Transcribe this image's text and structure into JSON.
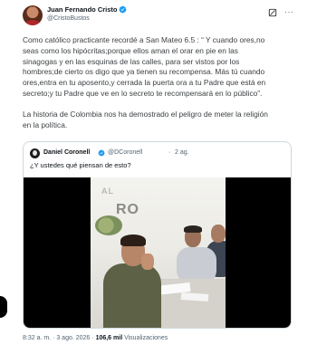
{
  "author": {
    "name": "Juan Fernando Cristo",
    "handle": "@CristoBustos"
  },
  "tweet": {
    "paragraph1": "Como católico practicante recordé a San Mateo 6.5 : “ Y cuando ores,no\nseas como los hipócritas;porque ellos aman el orar en pie en las\nsinagogas y en las esquinas de las calles, para ser vistos por los\nhombres;de cierto os digo que ya tienen su recompensa. Más tú cuando\nores,entra en tu aposento,y cerrada la puerta ora a tu Padre que está en\nsecreto;y tu Padre que ve en lo secreto te recompensará en lo público”.",
    "paragraph2": "La historia de Colombia nos ha demostrado el peligro de meter la religión\nen la política."
  },
  "quote": {
    "name": "Daniel Coronell",
    "handle": "@DCoronell",
    "separator": "·",
    "time": "2 ag.",
    "text": "¿Y ustedes qué piensan de esto?",
    "video_banner_small": "AL",
    "video_banner_big": "RO"
  },
  "footer": {
    "timestamp": "8:32 a. m. · 3 ago. 2026 · ",
    "views_count": "106,6 mil",
    "views_label": " Visualizaciones"
  },
  "colors": {
    "verified": "#1d9bf0",
    "secondary_text": "#536471",
    "border": "#cfd9de"
  },
  "icons": [
    "verified-badge-icon",
    "grok-icon",
    "more-options-icon"
  ]
}
